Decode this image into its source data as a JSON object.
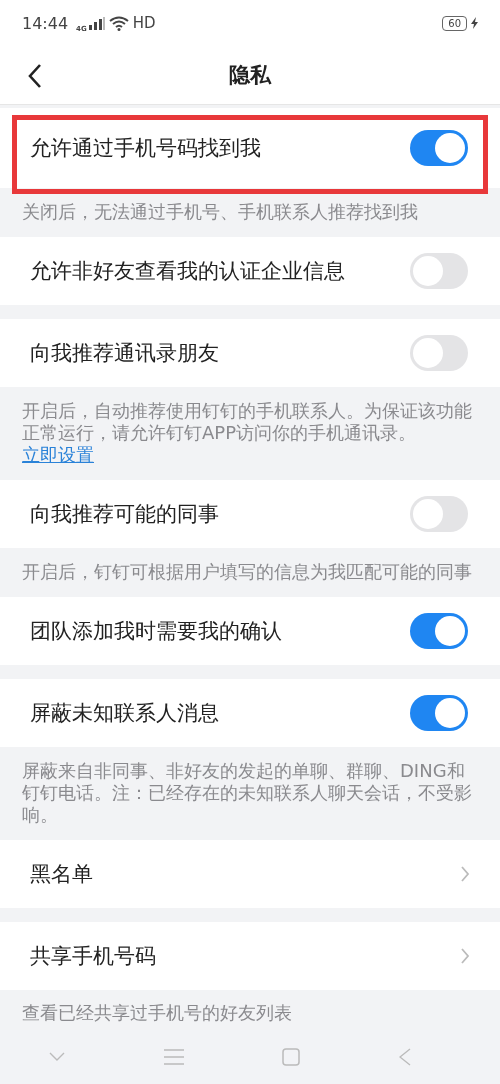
{
  "status_bar": {
    "time": "14:44",
    "network": "4G",
    "hd": "HD",
    "battery": "60"
  },
  "header": {
    "title": "隐私"
  },
  "items": [
    {
      "kind": "toggle",
      "label": "允许通过手机号码找到我",
      "on": true,
      "highlighted": true,
      "caption": "关闭后，无法通过手机号、手机联系人推荐找到我"
    },
    {
      "kind": "toggle",
      "label": "允许非好友查看我的认证企业信息",
      "on": false
    },
    {
      "kind": "toggle",
      "label": "向我推荐通讯录朋友",
      "on": false,
      "caption": "开启后，自动推荐使用钉钉的手机联系人。为保证该功能正常运行，请允许钉钉APP访问你的手机通讯录。",
      "caption_link": "立即设置"
    },
    {
      "kind": "toggle",
      "label": "向我推荐可能的同事",
      "on": false,
      "caption": "开启后，钉钉可根据用户填写的信息为我匹配可能的同事"
    },
    {
      "kind": "toggle",
      "label": "团队添加我时需要我的确认",
      "on": true
    },
    {
      "kind": "toggle",
      "label": "屏蔽未知联系人消息",
      "on": true,
      "caption": "屏蔽来自非同事、非好友的发起的单聊、群聊、DING和钉钉电话。注：已经存在的未知联系人聊天会话，不受影响。"
    },
    {
      "kind": "link",
      "label": "黑名单"
    },
    {
      "kind": "link",
      "label": "共享手机号码",
      "caption": "查看已经共享过手机号的好友列表"
    }
  ]
}
